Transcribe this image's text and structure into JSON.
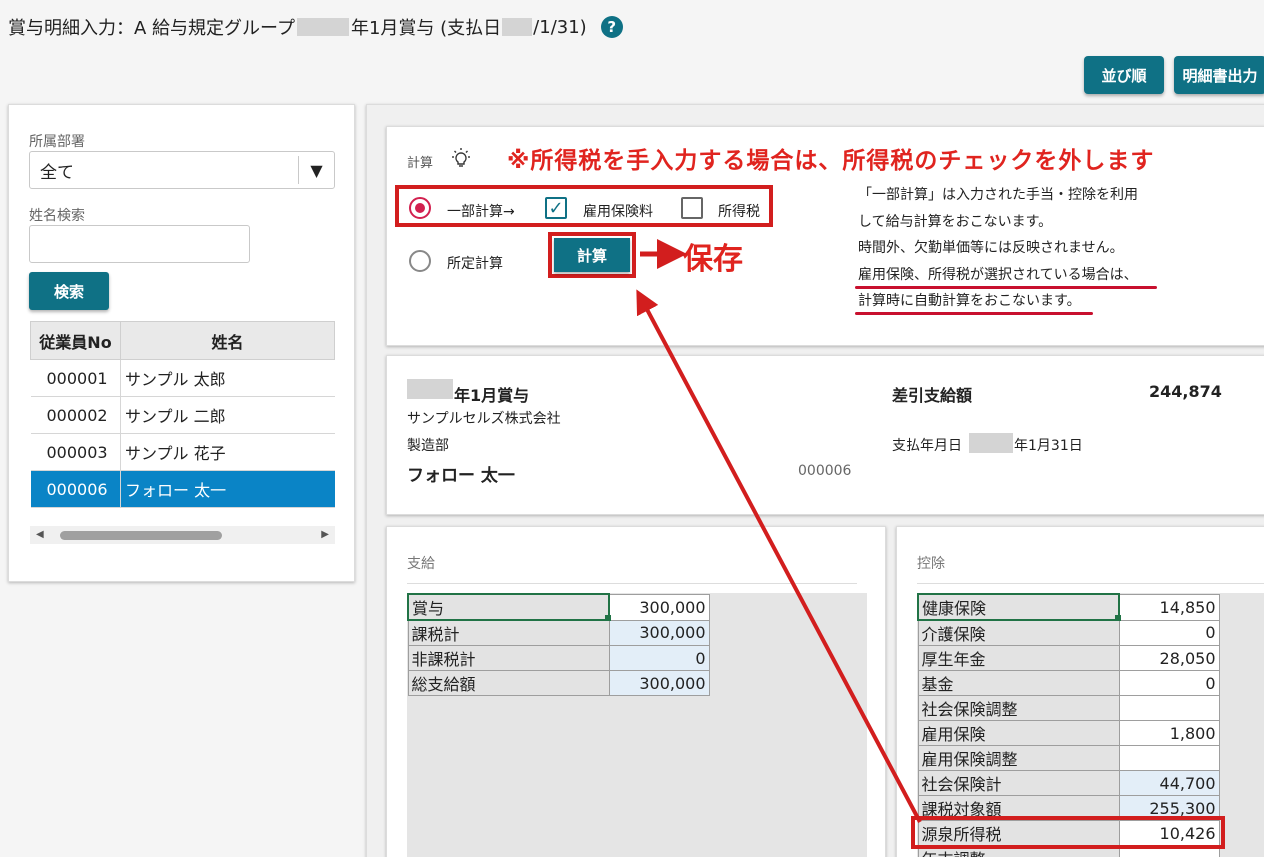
{
  "title": {
    "part1": "賞与明細入力：A 給与規定グループ",
    "part2": "年1月賞与 (支払日",
    "part3": "/1/31)"
  },
  "toolbar": {
    "sort_label": "並び順",
    "print_label": "明細書出力"
  },
  "sidebar": {
    "dept_label": "所属部署",
    "dept_value": "全て",
    "name_label": "姓名検索",
    "search_label": "検索",
    "table": {
      "headers": [
        "従業員No",
        "姓名"
      ],
      "rows": [
        {
          "no": "000001",
          "name": "サンプル 太郎"
        },
        {
          "no": "000002",
          "name": "サンプル 二郎"
        },
        {
          "no": "000003",
          "name": "サンプル 花子"
        },
        {
          "no": "000006",
          "name": "フォロー 太一"
        }
      ]
    }
  },
  "calc": {
    "label": "計算",
    "note": "※所得税を手入力する場合は、所得税のチェックを外します",
    "partial_label": "一部計算→",
    "employment_ins_label": "雇用保険料",
    "income_tax_label": "所得税",
    "fixed_label": "所定計算",
    "calc_button": "計算",
    "save_annotation": "保存",
    "desc": [
      "「一部計算」は入力された手当・控除を利用",
      "して給与計算をおこないます。",
      "時間外、欠勤単価等には反映されません。",
      "雇用保険、所得税が選択されている場合は、",
      "計算時に自動計算をおこないます。"
    ]
  },
  "info": {
    "bonus_title": "年1月賞与",
    "company": "サンプルセルズ株式会社",
    "dept": "製造部",
    "employee_name": "フォロー 太一",
    "employee_no": "000006",
    "net_label": "差引支給額",
    "net_value": "244,874",
    "paydate_label": "支払年月日",
    "paydate_value": "年1月31日"
  },
  "pay": {
    "title": "支給",
    "rows": [
      {
        "label": "賞与",
        "value": "300,000"
      },
      {
        "label": "課税計",
        "value": "300,000"
      },
      {
        "label": "非課税計",
        "value": "0"
      },
      {
        "label": "総支給額",
        "value": "300,000"
      }
    ]
  },
  "deduct": {
    "title": "控除",
    "rows": [
      {
        "label": "健康保険",
        "value": "14,850"
      },
      {
        "label": "介護保険",
        "value": "0"
      },
      {
        "label": "厚生年金",
        "value": "28,050"
      },
      {
        "label": "基金",
        "value": "0"
      },
      {
        "label": "社会保険調整",
        "value": ""
      },
      {
        "label": "雇用保険",
        "value": "1,800"
      },
      {
        "label": "雇用保険調整",
        "value": ""
      },
      {
        "label": "社会保険計",
        "value": "44,700"
      },
      {
        "label": "課税対象額",
        "value": "255,300"
      },
      {
        "label": "源泉所得税",
        "value": "10,426"
      },
      {
        "label": "年末調整",
        "value": ""
      }
    ]
  },
  "colors": {
    "accent": "#0f7185",
    "selected_row": "#0a84c6",
    "annotation": "#e0241f"
  },
  "icons": {
    "help": "question-circle-icon",
    "bulb": "lightbulb-icon",
    "dropdown": "triangle-down-icon"
  }
}
